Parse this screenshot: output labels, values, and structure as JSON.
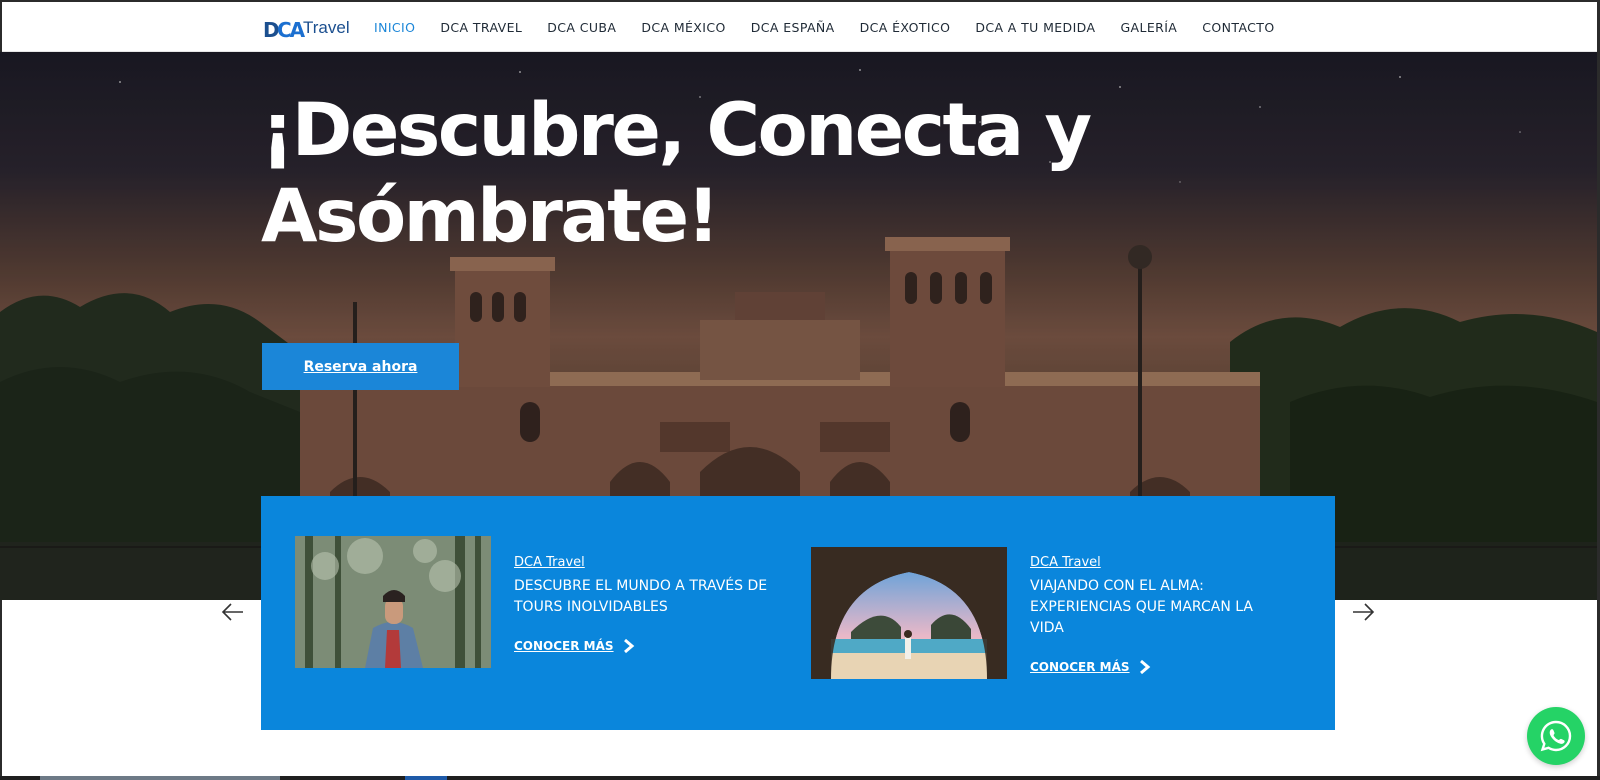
{
  "brand": {
    "logo_mark": "DCA",
    "logo_mark_d": "D",
    "logo_mark_ca": "CA",
    "logo_text": "Travel"
  },
  "nav": {
    "items": [
      {
        "label": "INICIO",
        "active": true
      },
      {
        "label": "DCA TRAVEL",
        "active": false
      },
      {
        "label": "DCA CUBA",
        "active": false
      },
      {
        "label": "DCA MÉXICO",
        "active": false
      },
      {
        "label": "DCA ESPAÑA",
        "active": false
      },
      {
        "label": "DCA ÉXOTICO",
        "active": false
      },
      {
        "label": "DCA A TU MEDIDA",
        "active": false
      },
      {
        "label": "GALERÍA",
        "active": false
      },
      {
        "label": "CONTACTO",
        "active": false
      }
    ]
  },
  "hero": {
    "title": "¡Descubre, Conecta y Asómbrate!",
    "cta_label": "Reserva ahora"
  },
  "slider": {
    "cards": [
      {
        "tag": "DCA Travel",
        "title": "DESCUBRE EL MUNDO A TRAVÉS DE TOURS INOLVIDABLES",
        "link_label": "CONOCER MÁS"
      },
      {
        "tag": "DCA Travel",
        "title": "VIAJANDO CON EL ALMA: EXPERIENCIAS QUE MARCAN LA VIDA",
        "link_label": "CONOCER MÁS"
      }
    ],
    "prev_icon": "arrow-left-icon",
    "next_icon": "arrow-right-icon"
  },
  "floating": {
    "icon": "whatsapp-icon"
  },
  "colors": {
    "accent": "#1b86d8",
    "slider_bg": "#0a86dc",
    "whatsapp": "#25d366"
  }
}
